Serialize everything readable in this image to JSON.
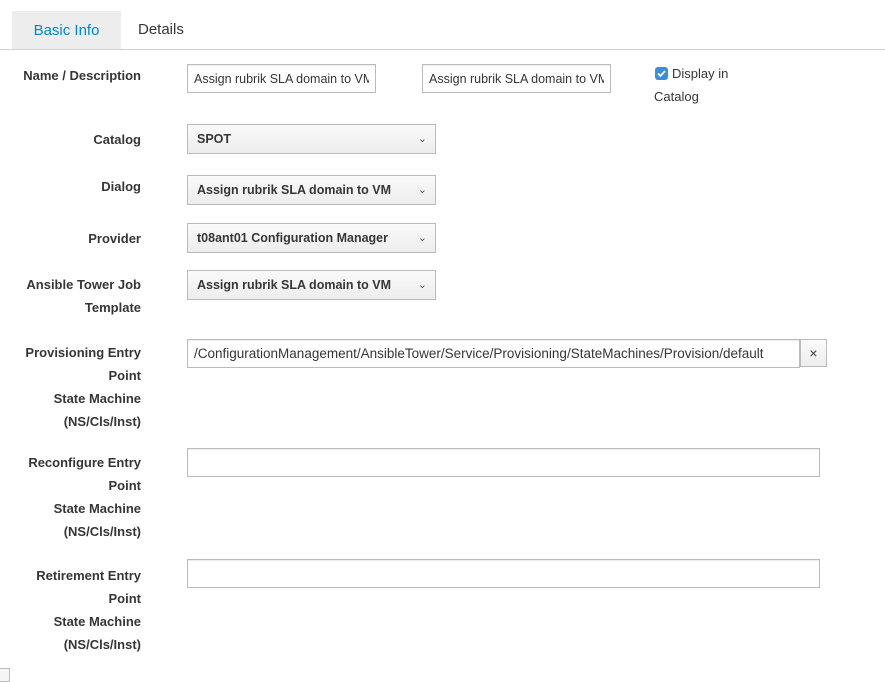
{
  "tabs": [
    {
      "label": "Basic Info",
      "active": true
    },
    {
      "label": "Details",
      "active": false
    }
  ],
  "name_description": {
    "label": "Name / Description",
    "name_value": "Assign rubrik SLA domain to VM",
    "description_value": "Assign rubrik SLA domain to VM",
    "display_in_catalog_line1": "Display in",
    "display_in_catalog_line2": "Catalog",
    "display_in_catalog_checked": true
  },
  "catalog": {
    "label": "Catalog",
    "value": "SPOT"
  },
  "dialog": {
    "label": "Dialog",
    "value": "Assign rubrik SLA domain to VM"
  },
  "provider": {
    "label": "Provider",
    "value": "t08ant01 Configuration Manager"
  },
  "job_template": {
    "label_line1": "Ansible Tower Job",
    "label_line2": "Template",
    "value": "Assign rubrik SLA domain to VM"
  },
  "provisioning_entry": {
    "label_lines": [
      "Provisioning Entry",
      "Point",
      "State Machine",
      "(NS/Cls/Inst)"
    ],
    "value": "/ConfigurationManagement/AnsibleTower/Service/Provisioning/StateMachines/Provision/default",
    "clear_symbol": "×"
  },
  "reconfigure_entry": {
    "label_lines": [
      "Reconfigure Entry",
      "Point",
      "State Machine",
      "(NS/Cls/Inst)"
    ],
    "value": ""
  },
  "retirement_entry": {
    "label_lines": [
      "Retirement Entry",
      "Point",
      "State Machine",
      "(NS/Cls/Inst)"
    ],
    "value": ""
  },
  "caret_symbol": "⌄",
  "colors": {
    "accent": "#0088ce",
    "checkbox": "#3b8ed8",
    "text": "#363636",
    "border": "#bbbbbb"
  }
}
